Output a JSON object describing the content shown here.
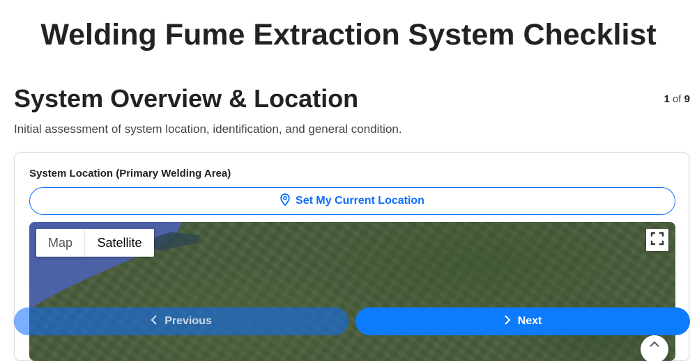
{
  "page": {
    "title": "Welding Fume Extraction System Checklist"
  },
  "section": {
    "title": "System Overview & Location",
    "description": "Initial assessment of system location, identification, and general condition.",
    "step_current": "1",
    "step_of": "of",
    "step_total": "9"
  },
  "location_field": {
    "label": "System Location (Primary Welding Area)",
    "button_label": "Set My Current Location",
    "button_icon": "map-pin-icon"
  },
  "map": {
    "type_options": [
      "Map",
      "Satellite"
    ],
    "selected_type": "Satellite",
    "fullscreen_icon": "fullscreen-icon",
    "camera_icon": "camera-control-icon"
  },
  "navigation": {
    "previous_label": "Previous",
    "next_label": "Next",
    "previous_enabled": false
  },
  "colors": {
    "accent": "#0d6efd",
    "next_button": "#0d7bfd"
  }
}
